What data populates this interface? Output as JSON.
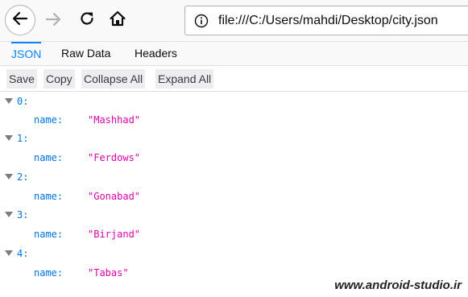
{
  "browser": {
    "url": "file:///C:/Users/mahdi/Desktop/city.json",
    "icons": {
      "back": "back-arrow-icon",
      "forward": "forward-arrow-icon",
      "reload": "reload-icon",
      "home": "home-icon",
      "info": "info-icon"
    }
  },
  "viewer": {
    "tabs": [
      {
        "label": "JSON",
        "selected": true
      },
      {
        "label": "Raw Data",
        "selected": false
      },
      {
        "label": "Headers",
        "selected": false
      }
    ],
    "toolbar": {
      "save": "Save",
      "copy": "Copy",
      "collapse_all": "Collapse All",
      "expand_all": "Expand All"
    },
    "items": [
      {
        "index": "0:",
        "key": "name:",
        "value": "\"Mashhad\""
      },
      {
        "index": "1:",
        "key": "name:",
        "value": "\"Ferdows\""
      },
      {
        "index": "2:",
        "key": "name:",
        "value": "\"Gonabad\""
      },
      {
        "index": "3:",
        "key": "name:",
        "value": "\"Birjand\""
      },
      {
        "index": "4:",
        "key": "name:",
        "value": "\"Tabas\""
      }
    ]
  },
  "watermark": "www.android-studio.ir",
  "colors": {
    "accent": "#0a84ff",
    "key": "#0074e8",
    "string": "#dd00a9",
    "toolbar_button_bg": "#ededf0"
  }
}
